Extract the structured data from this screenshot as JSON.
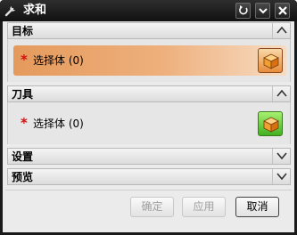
{
  "window": {
    "title": "求和",
    "icons": {
      "app": "wrench-icon",
      "reset": "reset-icon",
      "collapse": "chevron-down-icon",
      "close": "close-icon"
    }
  },
  "sections": {
    "target": {
      "title": "目标",
      "expanded": true,
      "required_mark": "*",
      "select_label": "选择体 (0)",
      "icon": "solid-body-cube-icon"
    },
    "tool": {
      "title": "刀具",
      "expanded": true,
      "required_mark": "*",
      "select_label": "选择体 (0)",
      "icon": "solid-body-cube-icon"
    },
    "settings": {
      "title": "设置",
      "expanded": false
    },
    "preview": {
      "title": "预览",
      "expanded": false
    }
  },
  "buttons": {
    "ok": "确定",
    "apply": "应用",
    "cancel": "取消"
  },
  "colors": {
    "active_selection": "#e8a060",
    "required": "#d01010",
    "titlebar": "#1a1a1a"
  }
}
